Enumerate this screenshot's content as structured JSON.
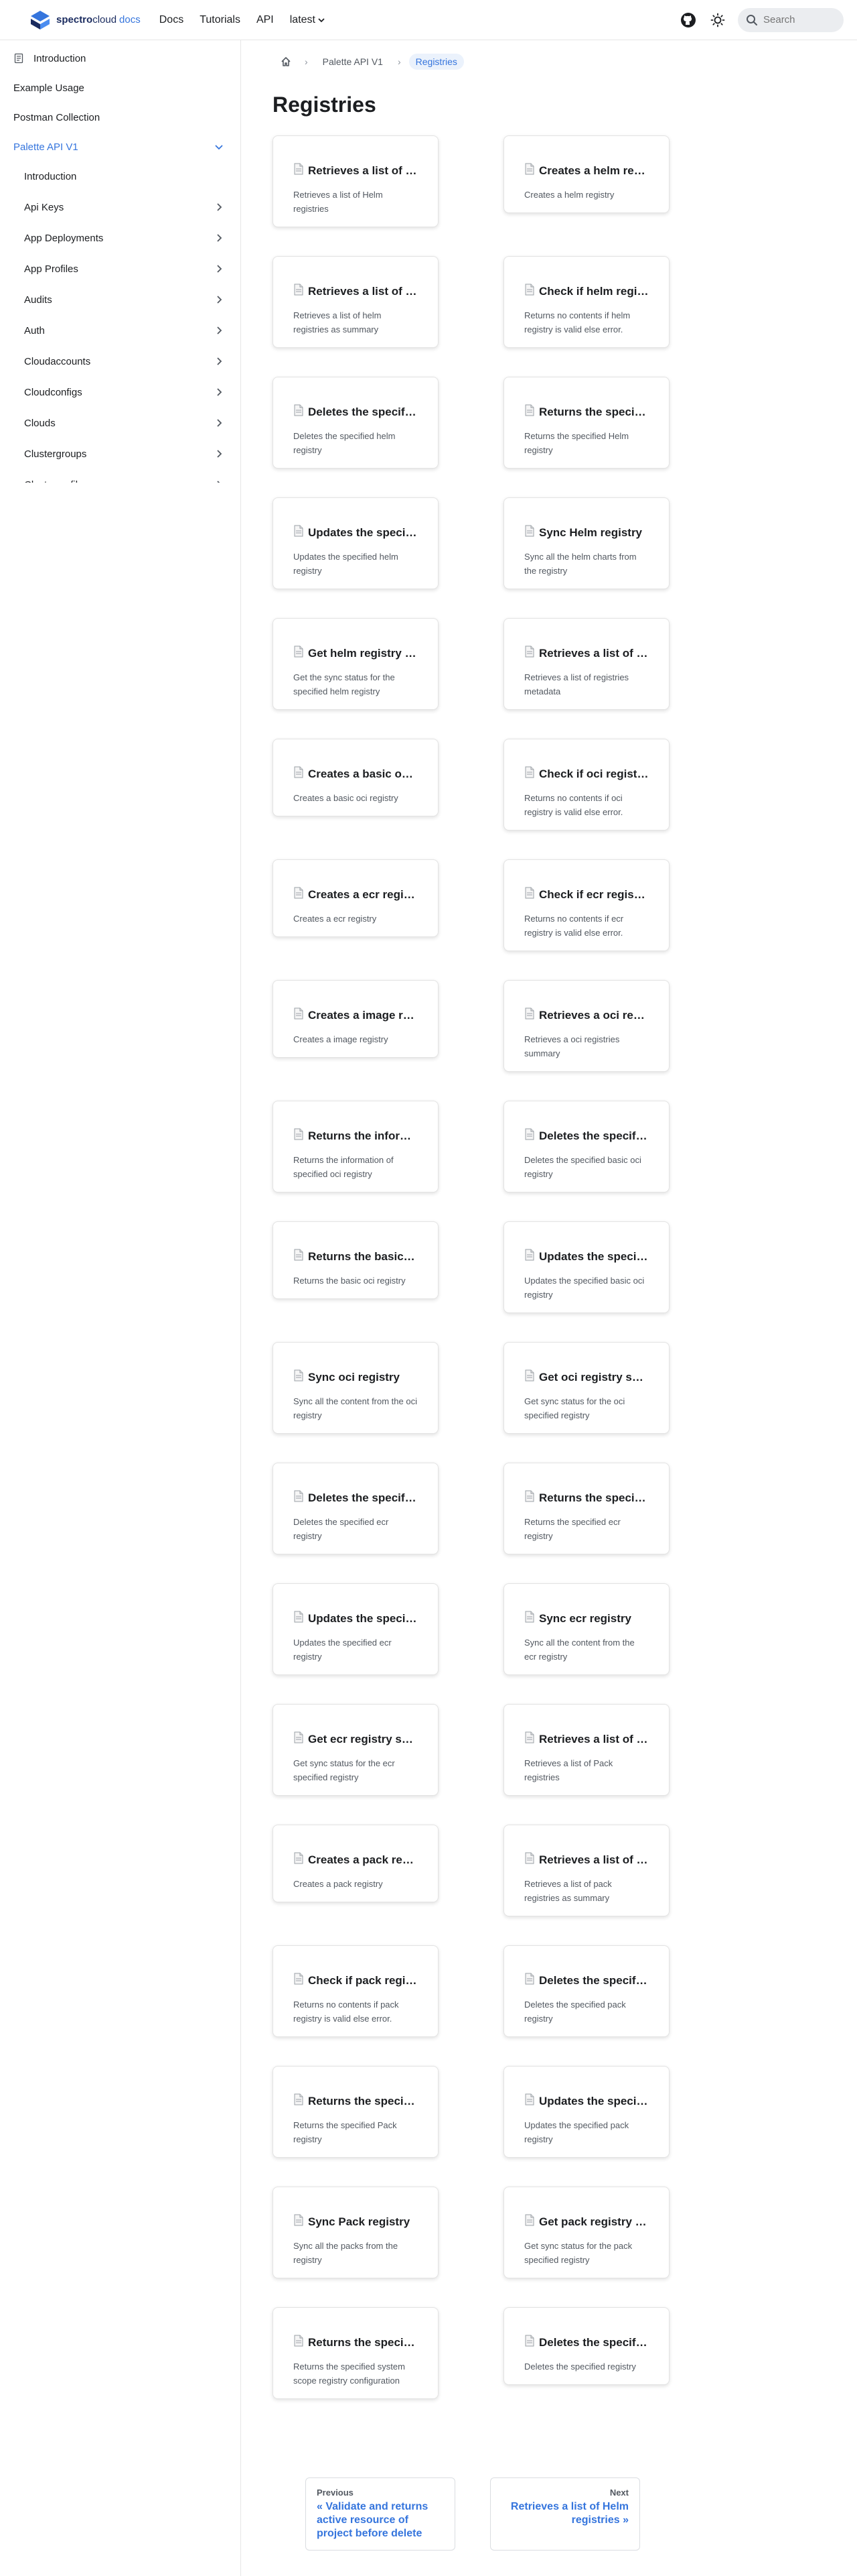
{
  "navbar": {
    "logo_text": "spectro",
    "logo_text_cloud": "cloud",
    "logo_docs": "docs",
    "links": [
      {
        "label": "Docs"
      },
      {
        "label": "Tutorials"
      },
      {
        "label": "API"
      },
      {
        "label": "latest"
      }
    ],
    "search_placeholder": "Search",
    "icons": {
      "github": "github-icon",
      "theme": "sun-icon",
      "search": "search-icon",
      "caret": "chevron-down-icon"
    }
  },
  "sidebar": {
    "items": [
      {
        "label": "Introduction",
        "icon": "document-icon"
      },
      {
        "label": "Example Usage"
      },
      {
        "label": "Postman Collection"
      },
      {
        "label": "Palette API V1",
        "active": true,
        "expanded": true
      }
    ],
    "sub_items": [
      {
        "label": "Introduction"
      },
      {
        "label": "Api Keys"
      },
      {
        "label": "App Deployments"
      },
      {
        "label": "App Profiles"
      },
      {
        "label": "Audits"
      },
      {
        "label": "Auth"
      },
      {
        "label": "Cloudaccounts"
      },
      {
        "label": "Cloudconfigs"
      },
      {
        "label": "Clouds"
      },
      {
        "label": "Clustergroups"
      },
      {
        "label": "Clusterprofiles"
      }
    ],
    "colors": {
      "active": "#3575dd"
    }
  },
  "breadcrumb": {
    "items": [
      "Palette API V1",
      "Registries"
    ],
    "sep": "›"
  },
  "page": {
    "title": "Registries"
  },
  "cards": [
    {
      "title": "Retrieves a list of Helm registries",
      "desc": "Retrieves a list of Helm registries"
    },
    {
      "title": "Creates a helm registry",
      "desc": "Creates a helm registry"
    },
    {
      "title": "Retrieves a list of helm registries as summary",
      "desc": "Retrieves a list of helm registries as summary"
    },
    {
      "title": "Check if helm registry is valid",
      "desc": "Returns no contents if helm registry is valid else error."
    },
    {
      "title": "Deletes the specified helm registry",
      "desc": "Deletes the specified helm registry"
    },
    {
      "title": "Returns the specified Helm registry",
      "desc": "Returns the specified Helm registry"
    },
    {
      "title": "Updates the specified helm registry",
      "desc": "Updates the specified helm registry"
    },
    {
      "title": "Sync Helm registry",
      "desc": "Sync all the helm charts from the registry"
    },
    {
      "title": "Get helm registry sync status",
      "desc": "Get the sync status for the specified helm registry"
    },
    {
      "title": "Retrieves a list of registries metadata",
      "desc": "Retrieves a list of registries metadata"
    },
    {
      "title": "Creates a basic oci registry",
      "desc": "Creates a basic oci registry"
    },
    {
      "title": "Check if oci registry is valid",
      "desc": "Returns no contents if oci registry is valid else error."
    },
    {
      "title": "Creates a ecr registry",
      "desc": "Creates a ecr registry"
    },
    {
      "title": "Check if ecr registry is valid",
      "desc": "Returns no contents if ecr registry is valid else error."
    },
    {
      "title": "Creates a image registry",
      "desc": "Creates a image registry"
    },
    {
      "title": "Retrieves a oci registries summary",
      "desc": "Retrieves a oci registries summary"
    },
    {
      "title": "Returns the information of specified oci registry",
      "desc": "Returns the information of specified oci registry"
    },
    {
      "title": "Deletes the specified basic oci registry",
      "desc": "Deletes the specified basic oci registry"
    },
    {
      "title": "Returns the basic oci registry",
      "desc": "Returns the basic oci registry"
    },
    {
      "title": "Updates the specified basic oci registry",
      "desc": "Updates the specified basic oci registry"
    },
    {
      "title": "Sync oci registry",
      "desc": "Sync all the content from the oci registry"
    },
    {
      "title": "Get oci registry sync status",
      "desc": "Get sync status for the oci specified registry"
    },
    {
      "title": "Deletes the specified ecr registry",
      "desc": "Deletes the specified ecr registry"
    },
    {
      "title": "Returns the specified ecr registry",
      "desc": "Returns the specified ecr registry"
    },
    {
      "title": "Updates the specified ecr registry",
      "desc": "Updates the specified ecr registry"
    },
    {
      "title": "Sync ecr registry",
      "desc": "Sync all the content from the ecr registry"
    },
    {
      "title": "Get ecr registry sync status",
      "desc": "Get sync status for the ecr specified registry"
    },
    {
      "title": "Retrieves a list of Pack registries",
      "desc": "Retrieves a list of Pack registries"
    },
    {
      "title": "Creates a pack registry",
      "desc": "Creates a pack registry"
    },
    {
      "title": "Retrieves a list of pack registries as summary",
      "desc": "Retrieves a list of pack registries as summary"
    },
    {
      "title": "Check if pack registry is valid",
      "desc": "Returns no contents if pack registry is valid else error."
    },
    {
      "title": "Deletes the specified pack registry",
      "desc": "Deletes the specified pack registry"
    },
    {
      "title": "Returns the specified Pack registry",
      "desc": "Returns the specified Pack registry"
    },
    {
      "title": "Updates the specified pack registry",
      "desc": "Updates the specified pack registry"
    },
    {
      "title": "Sync Pack registry",
      "desc": "Sync all the packs from the registry"
    },
    {
      "title": "Get pack registry sync status",
      "desc": "Get sync status for the pack specified registry"
    },
    {
      "title": "Returns the specified system scope registry configuration",
      "desc": "Returns the specified system scope registry configuration"
    },
    {
      "title": "Deletes the specified registry",
      "desc": "Deletes the specified registry"
    }
  ],
  "pager": {
    "prev_sub": "Previous",
    "prev_label": "« Validate and returns active resource of project before delete",
    "next_sub": "Next",
    "next_label": "Retrieves a list of Helm registries »"
  }
}
